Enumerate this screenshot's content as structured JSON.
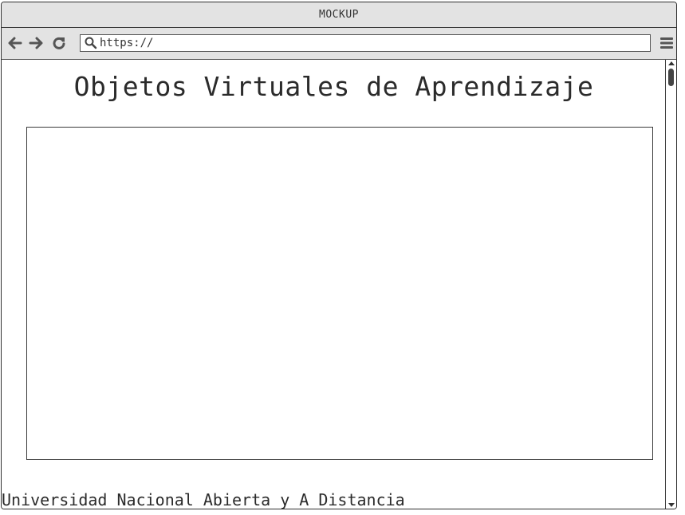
{
  "window": {
    "title": "MOCKUP"
  },
  "toolbar": {
    "back_icon": "arrow-left-icon",
    "forward_icon": "arrow-right-icon",
    "reload_icon": "reload-icon",
    "search_icon": "search-icon",
    "menu_icon": "hamburger-menu-icon",
    "address_value": "https://"
  },
  "main": {
    "heading": "Objetos Virtuales de Aprendizaje",
    "footer": "Universidad Nacional Abierta y A Distancia"
  },
  "colors": {
    "chrome_bg": "#e3e3e3",
    "border": "#3a3a3a",
    "icon": "#555555",
    "text": "#2b2b2b"
  }
}
